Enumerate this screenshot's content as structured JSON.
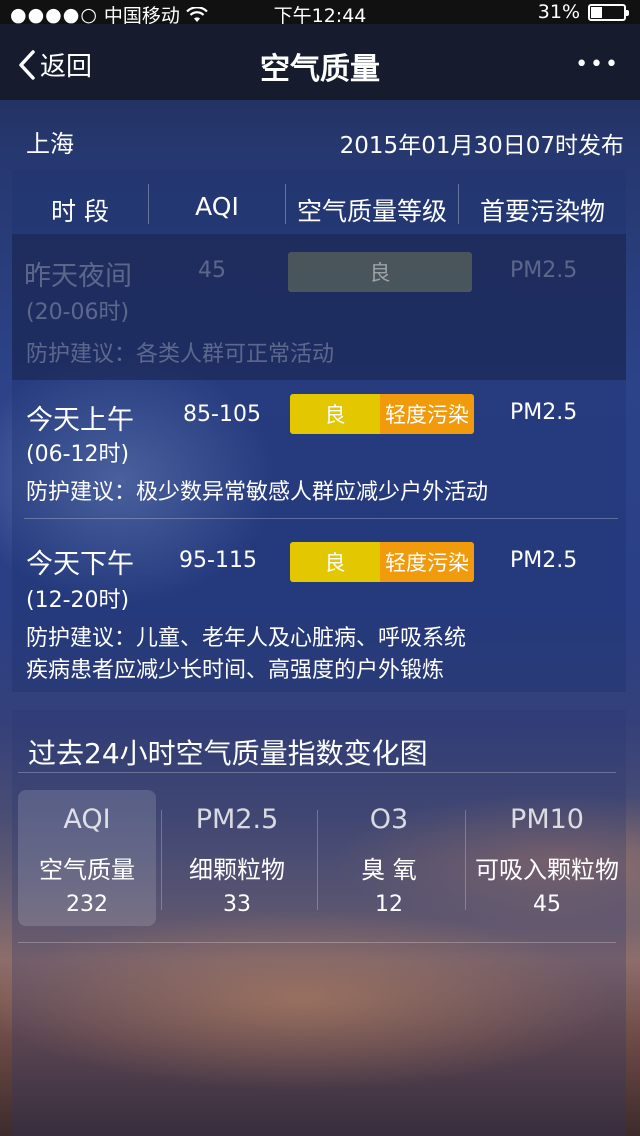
{
  "status_bar": {
    "signal": "●●●●○",
    "carrier": "中国移动",
    "time": "下午12:44",
    "battery": "31%"
  },
  "nav": {
    "back_label": "返回",
    "title": "空气质量",
    "more_label": "•••"
  },
  "location": {
    "city": "上海",
    "publish_time": "2015年01月30日07时发布"
  },
  "table": {
    "headers": [
      "时 段",
      "AQI",
      "空气质量等级",
      "首要污染物"
    ],
    "advice_prefix": "防护建议：",
    "rows": [
      {
        "period": "昨天夜间",
        "hours": "(20-06时)",
        "aqi": "45",
        "levels": [
          "良"
        ],
        "pollutant": "PM2.5",
        "advice": "各类人群可正常活动"
      },
      {
        "period": "今天上午",
        "hours": "(06-12时)",
        "aqi": "85-105",
        "levels": [
          "良",
          "轻度污染"
        ],
        "pollutant": "PM2.5",
        "advice": "极少数异常敏感人群应减少户外活动"
      },
      {
        "period": "今天下午",
        "hours": "(12-20时)",
        "aqi": "95-115",
        "levels": [
          "良",
          "轻度污染"
        ],
        "pollutant": "PM2.5",
        "advice_line1": "儿童、老年人及心脏病、呼吸系统",
        "advice_line2": "疾病患者应减少长时间、高强度的户外锻炼"
      }
    ]
  },
  "chart_section": {
    "title": "过去24小时空气质量指数变化图",
    "cards": [
      {
        "code": "AQI",
        "name": "空气质量",
        "value": "232"
      },
      {
        "code": "PM2.5",
        "name": "细颗粒物",
        "value": "33"
      },
      {
        "code": "O3",
        "name": "臭  氧",
        "value": "12"
      },
      {
        "code": "PM10",
        "name": "可吸入颗粒物",
        "value": "45"
      }
    ]
  },
  "colors": {
    "good": "#e3c700",
    "light_pollution": "#f19a0c",
    "navbar": "#161c2e"
  }
}
